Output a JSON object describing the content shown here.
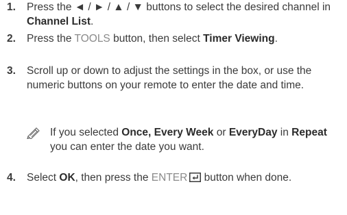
{
  "steps": [
    {
      "number": "1.",
      "parts": [
        {
          "text": "Press the ◄ / ► / ▲ / ▼ buttons to select the desired channel in ",
          "style": "plain"
        },
        {
          "text": "Channel List",
          "style": "bold"
        },
        {
          "text": ".",
          "style": "plain"
        }
      ]
    },
    {
      "number": "2.",
      "parts": [
        {
          "text": "Press the ",
          "style": "plain"
        },
        {
          "text": "TOOLS",
          "style": "key"
        },
        {
          "text": " button, then select ",
          "style": "plain"
        },
        {
          "text": "Timer Viewing",
          "style": "bold"
        },
        {
          "text": ".",
          "style": "plain"
        }
      ]
    },
    {
      "number": "3.",
      "parts": [
        {
          "text": "Scroll up or down to adjust the settings in the box, or use the numeric buttons on your remote to enter the date and time.",
          "style": "plain"
        }
      ]
    },
    {
      "number": "4.",
      "parts": [
        {
          "text": "Select ",
          "style": "plain"
        },
        {
          "text": "OK",
          "style": "bold"
        },
        {
          "text": ", then press the ",
          "style": "plain"
        },
        {
          "text": "ENTER",
          "style": "key"
        },
        {
          "text": "",
          "style": "enter-icon"
        },
        {
          "text": " button when done.",
          "style": "plain"
        }
      ]
    }
  ],
  "note": {
    "icon": "pencil-note-icon",
    "parts": [
      {
        "text": "If you selected ",
        "style": "plain"
      },
      {
        "text": "Once, Every Week",
        "style": "bold"
      },
      {
        "text": " or ",
        "style": "plain"
      },
      {
        "text": "EveryDay",
        "style": "bold"
      },
      {
        "text": " in ",
        "style": "plain"
      },
      {
        "text": "Repeat",
        "style": "bold"
      },
      {
        "text": " you can enter the date you want.",
        "style": "plain"
      }
    ]
  },
  "colors": {
    "text": "#3a3a3a",
    "key_text": "#8a8a8a"
  }
}
